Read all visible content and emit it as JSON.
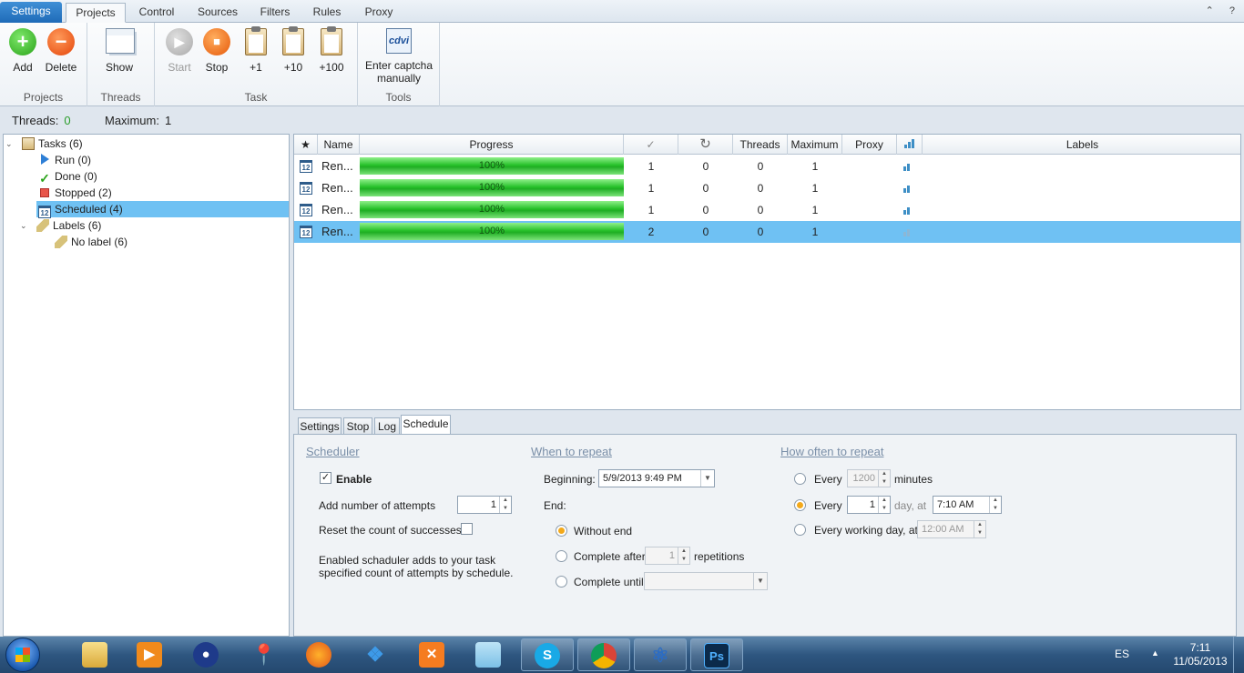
{
  "tabs": [
    "Settings",
    "Projects",
    "Control",
    "Sources",
    "Filters",
    "Rules",
    "Proxy"
  ],
  "window_buttons": [
    "⌃",
    "?"
  ],
  "ribbon": {
    "add": "Add",
    "delete": "Delete",
    "show": "Show",
    "start": "Start",
    "stop": "Stop",
    "plus1": "+1",
    "plus10": "+10",
    "plus100": "+100",
    "captcha_line1": "Enter captcha",
    "captcha_line2": "manually",
    "group_projects": "Projects",
    "group_threads": "Threads",
    "group_task": "Task",
    "group_tools": "Tools"
  },
  "status": {
    "threads_label": "Threads:",
    "threads_value": "0",
    "maximum_label": "Maximum:",
    "maximum_value": "1"
  },
  "tree": {
    "tasks": "Tasks (6)",
    "run": "Run (0)",
    "done": "Done (0)",
    "stopped": "Stopped (2)",
    "scheduled": "Scheduled (4)",
    "labels": "Labels (6)",
    "no_label": "No label (6)"
  },
  "grid": {
    "headers": {
      "name": "Name",
      "progress": "Progress",
      "threads": "Threads",
      "maximum": "Maximum",
      "proxy": "Proxy",
      "labels": "Labels"
    },
    "rows": [
      {
        "name": "Ren...",
        "progress": "100%",
        "done": "1",
        "retry": "0",
        "threads": "0",
        "maximum": "1",
        "proxy": ""
      },
      {
        "name": "Ren...",
        "progress": "100%",
        "done": "1",
        "retry": "0",
        "threads": "0",
        "maximum": "1",
        "proxy": ""
      },
      {
        "name": "Ren...",
        "progress": "100%",
        "done": "1",
        "retry": "0",
        "threads": "0",
        "maximum": "1",
        "proxy": ""
      },
      {
        "name": "Ren...",
        "progress": "100%",
        "done": "2",
        "retry": "0",
        "threads": "0",
        "maximum": "1",
        "proxy": ""
      }
    ]
  },
  "bottom_tabs": [
    "Settings",
    "Stop",
    "Log",
    "Schedule"
  ],
  "schedule": {
    "scheduler_title": "Scheduler",
    "enable": "Enable",
    "enable_checked": true,
    "add_attempts_label": "Add number of attempts",
    "add_attempts_value": "1",
    "reset_label": "Reset the count of successes",
    "description": "Enabled schaduler adds to your task specified count of attempts by schedule.",
    "when_title": "When to repeat",
    "beginning_label": "Beginning:",
    "beginning_value": "5/9/2013 9:49 PM",
    "end_label": "End:",
    "without_end": "Without end",
    "complete_after": "Complete after",
    "complete_after_value": "1",
    "repetitions": "repetitions",
    "complete_until": "Complete untill",
    "how_title": "How often to repeat",
    "every1": "Every",
    "every1_value": "1200",
    "minutes": "minutes",
    "every2": "Every",
    "every2_value": "1",
    "day_at": "day, at",
    "time_value": "7:10 AM",
    "every_working": "Every working day, at",
    "working_time": "12:00 AM"
  },
  "taskbar": {
    "lang": "ES",
    "time": "7:11",
    "date": "11/05/2013"
  },
  "colors": {
    "accent": "#1f6bb8",
    "selection": "#6fc1f3",
    "progress": "#27c12a"
  }
}
